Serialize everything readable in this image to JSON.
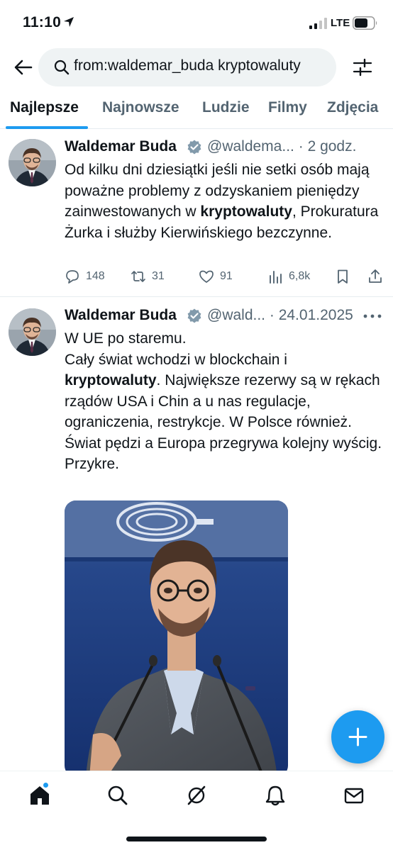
{
  "status_bar": {
    "time": "11:10",
    "network": "LTE"
  },
  "search": {
    "query": "from:waldemar_buda kryptowaluty"
  },
  "tabs": [
    {
      "label": "Najlepsze",
      "active": true
    },
    {
      "label": "Najnowsze",
      "active": false
    },
    {
      "label": "Ludzie",
      "active": false
    },
    {
      "label": "Filmy",
      "active": false
    },
    {
      "label": "Zdjęcia",
      "active": false
    }
  ],
  "tweets": [
    {
      "name": "Waldemar Buda",
      "handle": "@waldema...",
      "separator": "·",
      "time": "2 godz.",
      "text_before": "Od kilku dni dziesiątki jeśli nie setki osób mają poważne problemy z odzyskaniem pieniędzy zainwestowanych w ",
      "text_bold": "kryptowaluty",
      "text_after": ", Prokuratura Żurka i służby Kierwińskiego bezczynne.",
      "replies": "148",
      "retweets": "31",
      "likes": "91",
      "views": "6,8k"
    },
    {
      "name": "Waldemar Buda",
      "handle": "@wald...",
      "separator": "·",
      "time": "24.01.2025",
      "line1": "W UE po staremu.",
      "line2": "Cały świat wchodzi w blockchain i",
      "text_bold": "kryptowaluty",
      "text_after": ". Największe rezerwy są w rękach rządów USA i Chin a u nas regulacje, ograniczenia, restrykcje. W Polsce również. Świat pędzi a Europa przegrywa kolejny wyścig.",
      "last_line": "Przykre."
    }
  ],
  "colors": {
    "accent": "#1d9bf0",
    "text": "#0f1419",
    "secondary": "#536471"
  }
}
